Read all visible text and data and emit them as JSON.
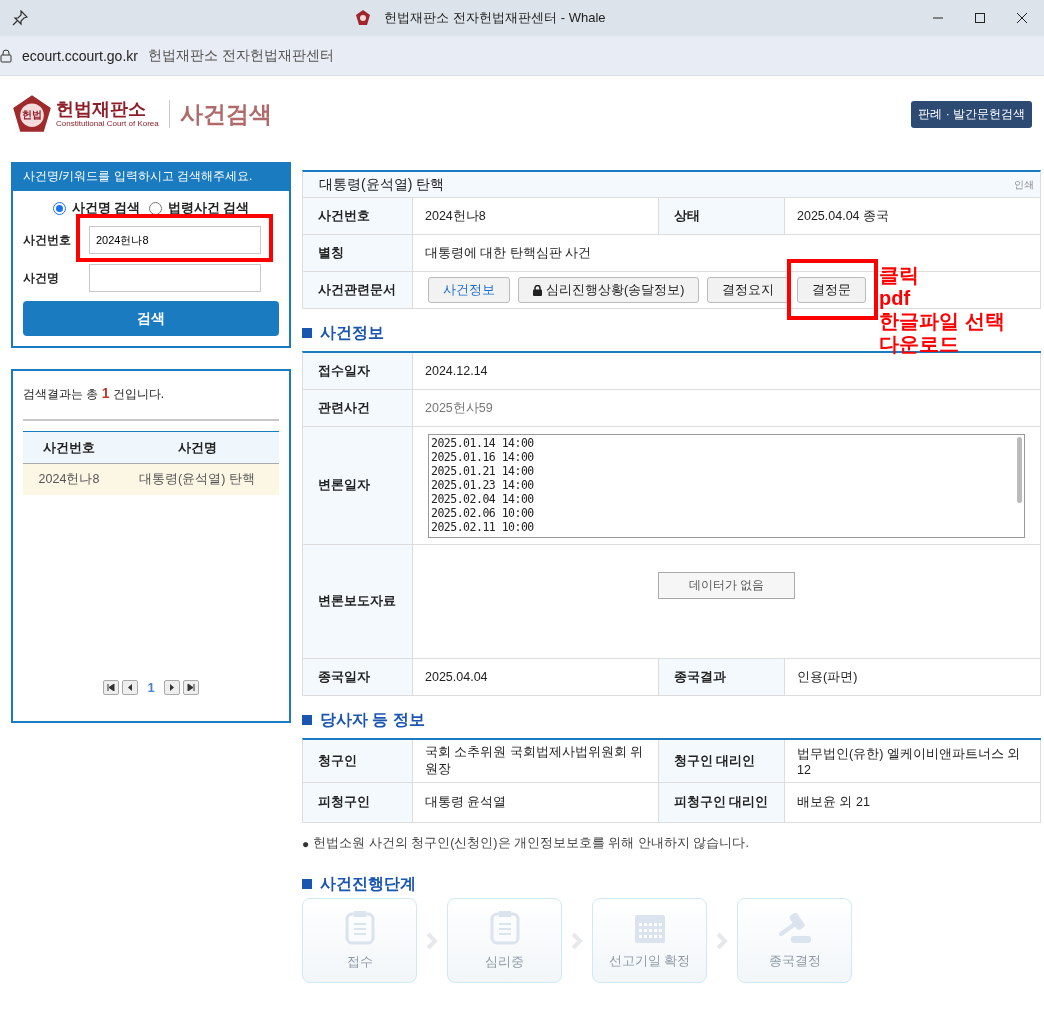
{
  "window": {
    "title": "헌법재판소 전자헌법재판센터 - Whale"
  },
  "address_bar": {
    "url": "ecourt.ccourt.go.kr",
    "page_title": "헌법재판소 전자헌법재판센터"
  },
  "header": {
    "logo_name": "헌법재판소",
    "logo_subtitle": "Constitutional Court of Korea",
    "logo_badge": "헌법",
    "page_title": "사건검색",
    "top_button": "판례 · 발간문헌검색"
  },
  "search_panel": {
    "heading": "사건명/키워드를 입력하시고 검색해주세요.",
    "modes": [
      {
        "label": "사건명 검색",
        "selected": true
      },
      {
        "label": "법령사건 검색",
        "selected": false
      }
    ],
    "fields": [
      {
        "label": "사건번호",
        "value": "2024헌나8",
        "highlighted": true
      },
      {
        "label": "사건명",
        "highlighted": false
      }
    ],
    "button": "검색"
  },
  "results_panel": {
    "summary": "검색결과는 총 **1** 건입니다.",
    "columns": [
      "사건번호",
      "사건명"
    ],
    "rows": [
      {
        "number": "2024헌나8",
        "name": "대통령(윤석열) 탄핵",
        "selected": true
      }
    ],
    "pages": [
      "1"
    ]
  },
  "case": {
    "title": "대통령(윤석열) 탄핵",
    "print_link": "인쇄",
    "rows": [
      {
        "kind": "pair",
        "label": "사건번호",
        "value": "2024헌나8",
        "label_2": "상태",
        "value_2": "2025.04.04 종국"
      },
      {
        "kind": "text",
        "label": "별칭",
        "value": "대통령에 대한 탄핵심판 사건"
      },
      {
        "kind": "docs",
        "label": "사건관련문서",
        "buttons": [
          {
            "label": "사건정보",
            "selected": true,
            "locked": false,
            "highlighted": false
          },
          {
            "label": "심리진행상황(송달정보)",
            "selected": false,
            "locked": true,
            "highlighted": false
          },
          {
            "label": "결정요지",
            "selected": false,
            "locked": false,
            "highlighted": false
          },
          {
            "label": "결정문",
            "selected": false,
            "locked": false,
            "highlighted": true
          }
        ]
      }
    ]
  },
  "annotation": [
    "클릭",
    "pdf",
    "한글파일 선택",
    "다운로드"
  ],
  "sections": [
    {
      "title": "사건정보",
      "rows": [
        {
          "kind": "text",
          "label": "접수일자",
          "value": "2024.12.14"
        },
        {
          "kind": "link",
          "label": "관련사건",
          "value": "2025헌사59"
        },
        {
          "kind": "list",
          "label": "변론일자",
          "items": [
            "2025.01.14 14:00",
            "2025.01.16 14:00",
            "2025.01.21 14:00",
            "2025.01.23 14:00",
            "2025.02.04 14:00",
            "2025.02.06 10:00",
            "2025.02.11 10:00"
          ]
        },
        {
          "kind": "empty",
          "label": "변론보도자료",
          "value": "데이터가 없음"
        },
        {
          "kind": "pair",
          "label": "종국일자",
          "value": "2025.04.04",
          "label_2": "종국결과",
          "value_2": "인용(파면)"
        }
      ]
    },
    {
      "title": "당사자 등 정보",
      "rows": [
        {
          "kind": "pair",
          "label": "청구인",
          "value": "국회 소추위원 국회법제사법위원회 위원장",
          "label_2": "청구인 대리인",
          "value_2": "법무법인(유한) 엘케이비앤파트너스 외 12"
        },
        {
          "kind": "pair",
          "label": "피청구인",
          "value": "대통령 윤석열",
          "label_2": "피청구인 대리인",
          "value_2": "배보윤 외 21"
        }
      ]
    }
  ],
  "note_bullet": "●",
  "note": "헌법소원 사건의 청구인(신청인)은 개인정보보호를 위해 안내하지 않습니다.",
  "progress": {
    "title": "사건진행단계",
    "stages": [
      {
        "label": "접수",
        "kind": "clipboard",
        "active": false
      },
      {
        "label": "심리중",
        "kind": "clipboard",
        "active": false
      },
      {
        "label": "선고기일 확정",
        "kind": "calendar",
        "active": false
      },
      {
        "label": "종국결정",
        "kind": "gavel",
        "active": false
      }
    ]
  }
}
